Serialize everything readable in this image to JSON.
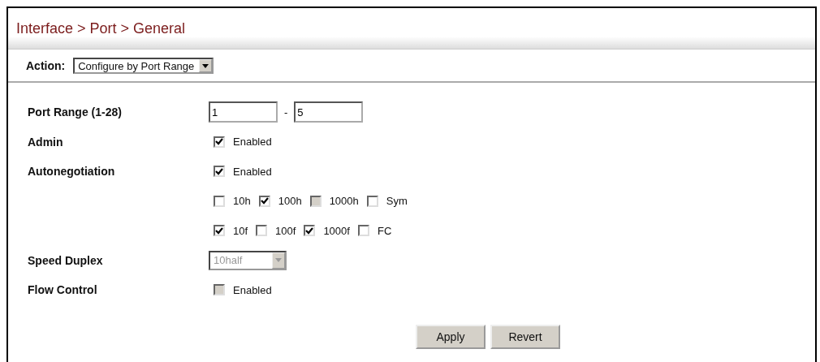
{
  "title": "Interface > Port > General",
  "action": {
    "label": "Action:",
    "value": "Configure by Port Range"
  },
  "rows": [
    {
      "kind": "range",
      "label": "Port Range (1-28)",
      "from": "1",
      "separator": "-",
      "to": "5"
    },
    {
      "kind": "checkboxes",
      "label": "Admin",
      "options": [
        {
          "label": "Enabled",
          "checked": true,
          "disabled": false
        }
      ]
    },
    {
      "kind": "checkboxes",
      "label": "Autonegotiation",
      "options": [
        {
          "label": "Enabled",
          "checked": true,
          "disabled": false
        }
      ]
    },
    {
      "kind": "checkboxes",
      "options": [
        {
          "label": "10h",
          "checked": false,
          "disabled": false
        },
        {
          "label": "100h",
          "checked": true,
          "disabled": false
        },
        {
          "label": "1000h",
          "checked": false,
          "disabled": true
        },
        {
          "label": "Sym",
          "checked": false,
          "disabled": false
        }
      ]
    },
    {
      "kind": "checkboxes",
      "options": [
        {
          "label": "10f",
          "checked": true,
          "disabled": false
        },
        {
          "label": "100f",
          "checked": false,
          "disabled": false
        },
        {
          "label": "1000f",
          "checked": true,
          "disabled": false
        },
        {
          "label": "FC",
          "checked": false,
          "disabled": false
        }
      ]
    },
    {
      "kind": "select",
      "label": "Speed Duplex",
      "value": "10half",
      "disabled": true
    },
    {
      "kind": "checkboxes",
      "label": "Flow Control",
      "options": [
        {
          "label": "Enabled",
          "checked": false,
          "disabled": true
        }
      ]
    }
  ],
  "buttons": [
    "Apply",
    "Revert"
  ]
}
